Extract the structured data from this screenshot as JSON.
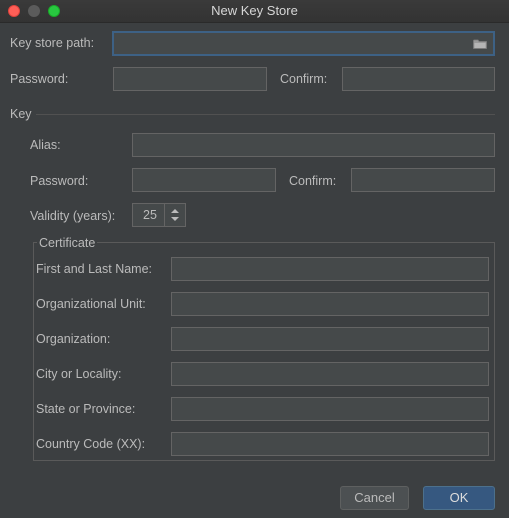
{
  "window": {
    "title": "New Key Store"
  },
  "keystore": {
    "path_label": "Key store path:",
    "path_value": "",
    "password_label": "Password:",
    "confirm_label": "Confirm:"
  },
  "key": {
    "section_label": "Key",
    "alias_label": "Alias:",
    "password_label": "Password:",
    "confirm_label": "Confirm:",
    "validity_label": "Validity (years):",
    "validity_value": "25"
  },
  "certificate": {
    "section_label": "Certificate",
    "fields": [
      {
        "label": "First and Last Name:"
      },
      {
        "label": "Organizational Unit:"
      },
      {
        "label": "Organization:"
      },
      {
        "label": "City or Locality:"
      },
      {
        "label": "State or Province:"
      },
      {
        "label": "Country Code (XX):"
      }
    ]
  },
  "buttons": {
    "cancel": "Cancel",
    "ok": "OK"
  },
  "icons": {
    "browse": "folder-icon",
    "spinner": "up-down-arrows-icon"
  },
  "colors": {
    "background": "#3c3f41",
    "field_background": "#45494a",
    "focus_border": "#3d6185",
    "ok_button": "#365880",
    "close_light": "#ff5f57",
    "zoom_light": "#28c840"
  }
}
